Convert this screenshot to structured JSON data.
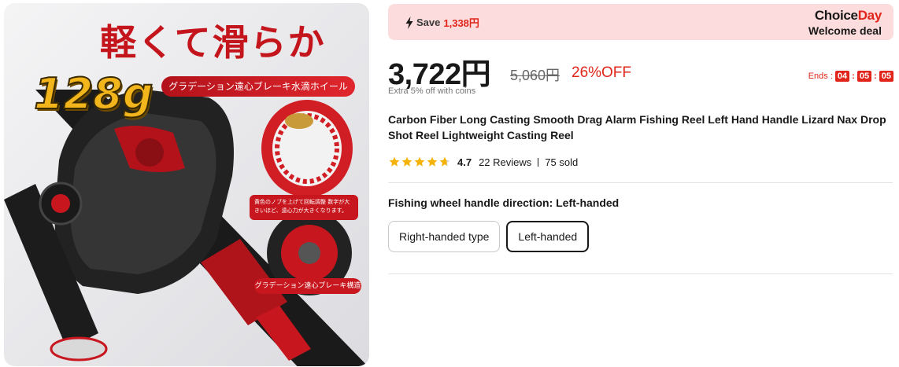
{
  "image": {
    "headline": "軽くて滑らか",
    "weight": "128g",
    "banner": "グラデーション遠心ブレーキ水滴ホイール",
    "caption1": "黄色のノブを上げて回転調整 数字が大きいほど、遠心力が大きくなります。",
    "caption2": "グラデーション遠心ブレーキ構造"
  },
  "deal": {
    "save_label": "Save",
    "save_amount": "1,338円",
    "brand_choice": "Choice",
    "brand_day": "Day",
    "welcome": "Welcome deal"
  },
  "price": {
    "current": "3,722円",
    "original": "5,060円",
    "discount": "26%OFF",
    "extra": "Extra 5% off with coins"
  },
  "countdown": {
    "label": "Ends :",
    "hours": "04",
    "minutes": "05",
    "seconds": "05"
  },
  "product": {
    "title": "Carbon Fiber Long Casting Smooth Drag Alarm Fishing Reel Left Hand Handle Lizard Nax Drop Shot Reel Lightweight Casting Reel"
  },
  "rating": {
    "value": "4.7",
    "stars": 4.7,
    "reviews": "22 Reviews",
    "sold": "75 sold"
  },
  "variant": {
    "label": "Fishing wheel handle direction: Left-handed",
    "options": [
      "Right-handed type",
      "Left-handed"
    ],
    "selected": "Left-handed"
  },
  "colors": {
    "accent_red": "#e1251b",
    "star_gold": "#f5b301",
    "banner_bg": "#fcdcdc"
  }
}
